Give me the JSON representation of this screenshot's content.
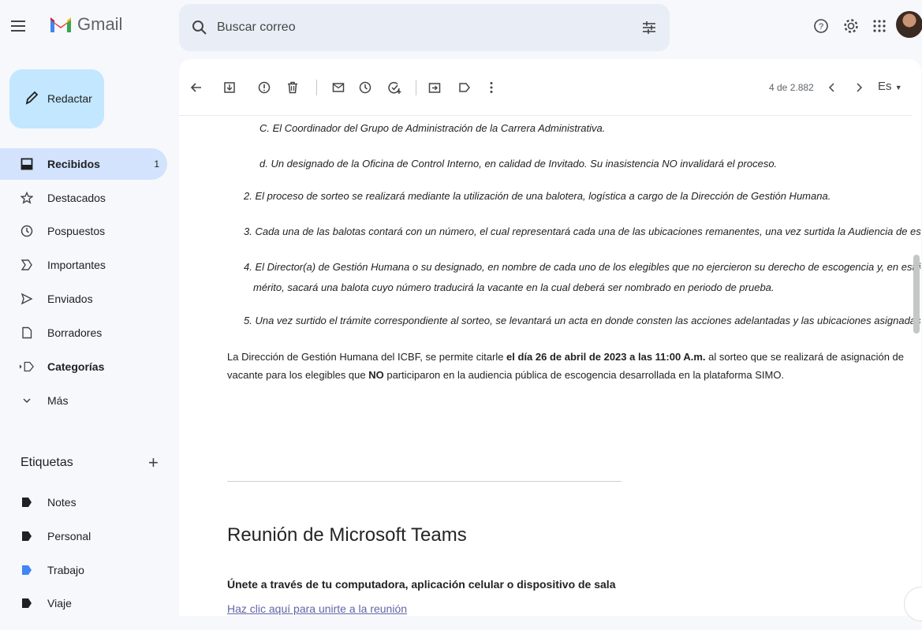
{
  "app": {
    "name": "Gmail"
  },
  "search": {
    "placeholder": "Buscar correo"
  },
  "compose": {
    "label": "Redactar"
  },
  "sidebar": {
    "items": [
      {
        "label": "Recibidos",
        "count": "1",
        "icon": "inbox-icon"
      },
      {
        "label": "Destacados",
        "icon": "star-icon"
      },
      {
        "label": "Pospuestos",
        "icon": "clock-icon"
      },
      {
        "label": "Importantes",
        "icon": "important-icon"
      },
      {
        "label": "Enviados",
        "icon": "send-icon"
      },
      {
        "label": "Borradores",
        "icon": "draft-icon"
      },
      {
        "label": "Categorías",
        "icon": "category-icon"
      },
      {
        "label": "Más",
        "icon": "chevron-down-icon"
      }
    ],
    "labels_title": "Etiquetas",
    "labels": [
      {
        "label": "Notes",
        "color": "#202124"
      },
      {
        "label": "Personal",
        "color": "#202124"
      },
      {
        "label": "Trabajo",
        "color": "#4285f4"
      },
      {
        "label": "Viaje",
        "color": "#202124"
      }
    ]
  },
  "toolbar": {
    "pager": "4 de 2.882",
    "lang": "Es"
  },
  "email": {
    "c": "C. El Coordinador del Grupo de Administración de la Carrera Administrativa.",
    "d": "d. Un designado de la Oficina de Control Interno, en calidad de Invitado. Su inasistencia NO invalidará el proceso.",
    "p2": "2. El proceso de sorteo se realizará mediante la utilización de una balotera, logística a cargo de la Dirección de Gestión Humana.",
    "p3": "3. Cada una de las balotas contará con un número, el cual representará cada una de las ubicaciones remanentes, una vez surtida la Audiencia de escogencia.",
    "p4a": "4. El Director(a) de Gestión Humana o su designado, en nombre de cada uno de los elegibles que no ejercieron su derecho de escogencia y, en estricto orden de",
    "p4b": "mérito, sacará una balota cuyo número traducirá la vacante en la cual deberá ser nombrado en periodo de prueba.",
    "p5": "5. Una vez surtido el trámite correspondiente al sorteo, se levantará un acta en donde consten las acciones adelantadas y las ubicaciones asignadas”",
    "para_1": "La Dirección de Gestión Humana del ICBF, se permite citarle ",
    "para_bold": "el día 26 de abril de 2023 a las 11:00 A.m.",
    "para_2": " al sorteo que se realizará de asignación de vacante para los elegibles que ",
    "para_no": "NO",
    "para_3": " participaron en la audiencia pública de escogencia desarrollada en la plataforma SIMO.",
    "teams_title": "Reunión de Microsoft Teams",
    "teams_sub": "Únete a través de tu computadora, aplicación celular o dispositivo de sala",
    "teams_link": "Haz clic aquí para unirte a la reunión"
  }
}
